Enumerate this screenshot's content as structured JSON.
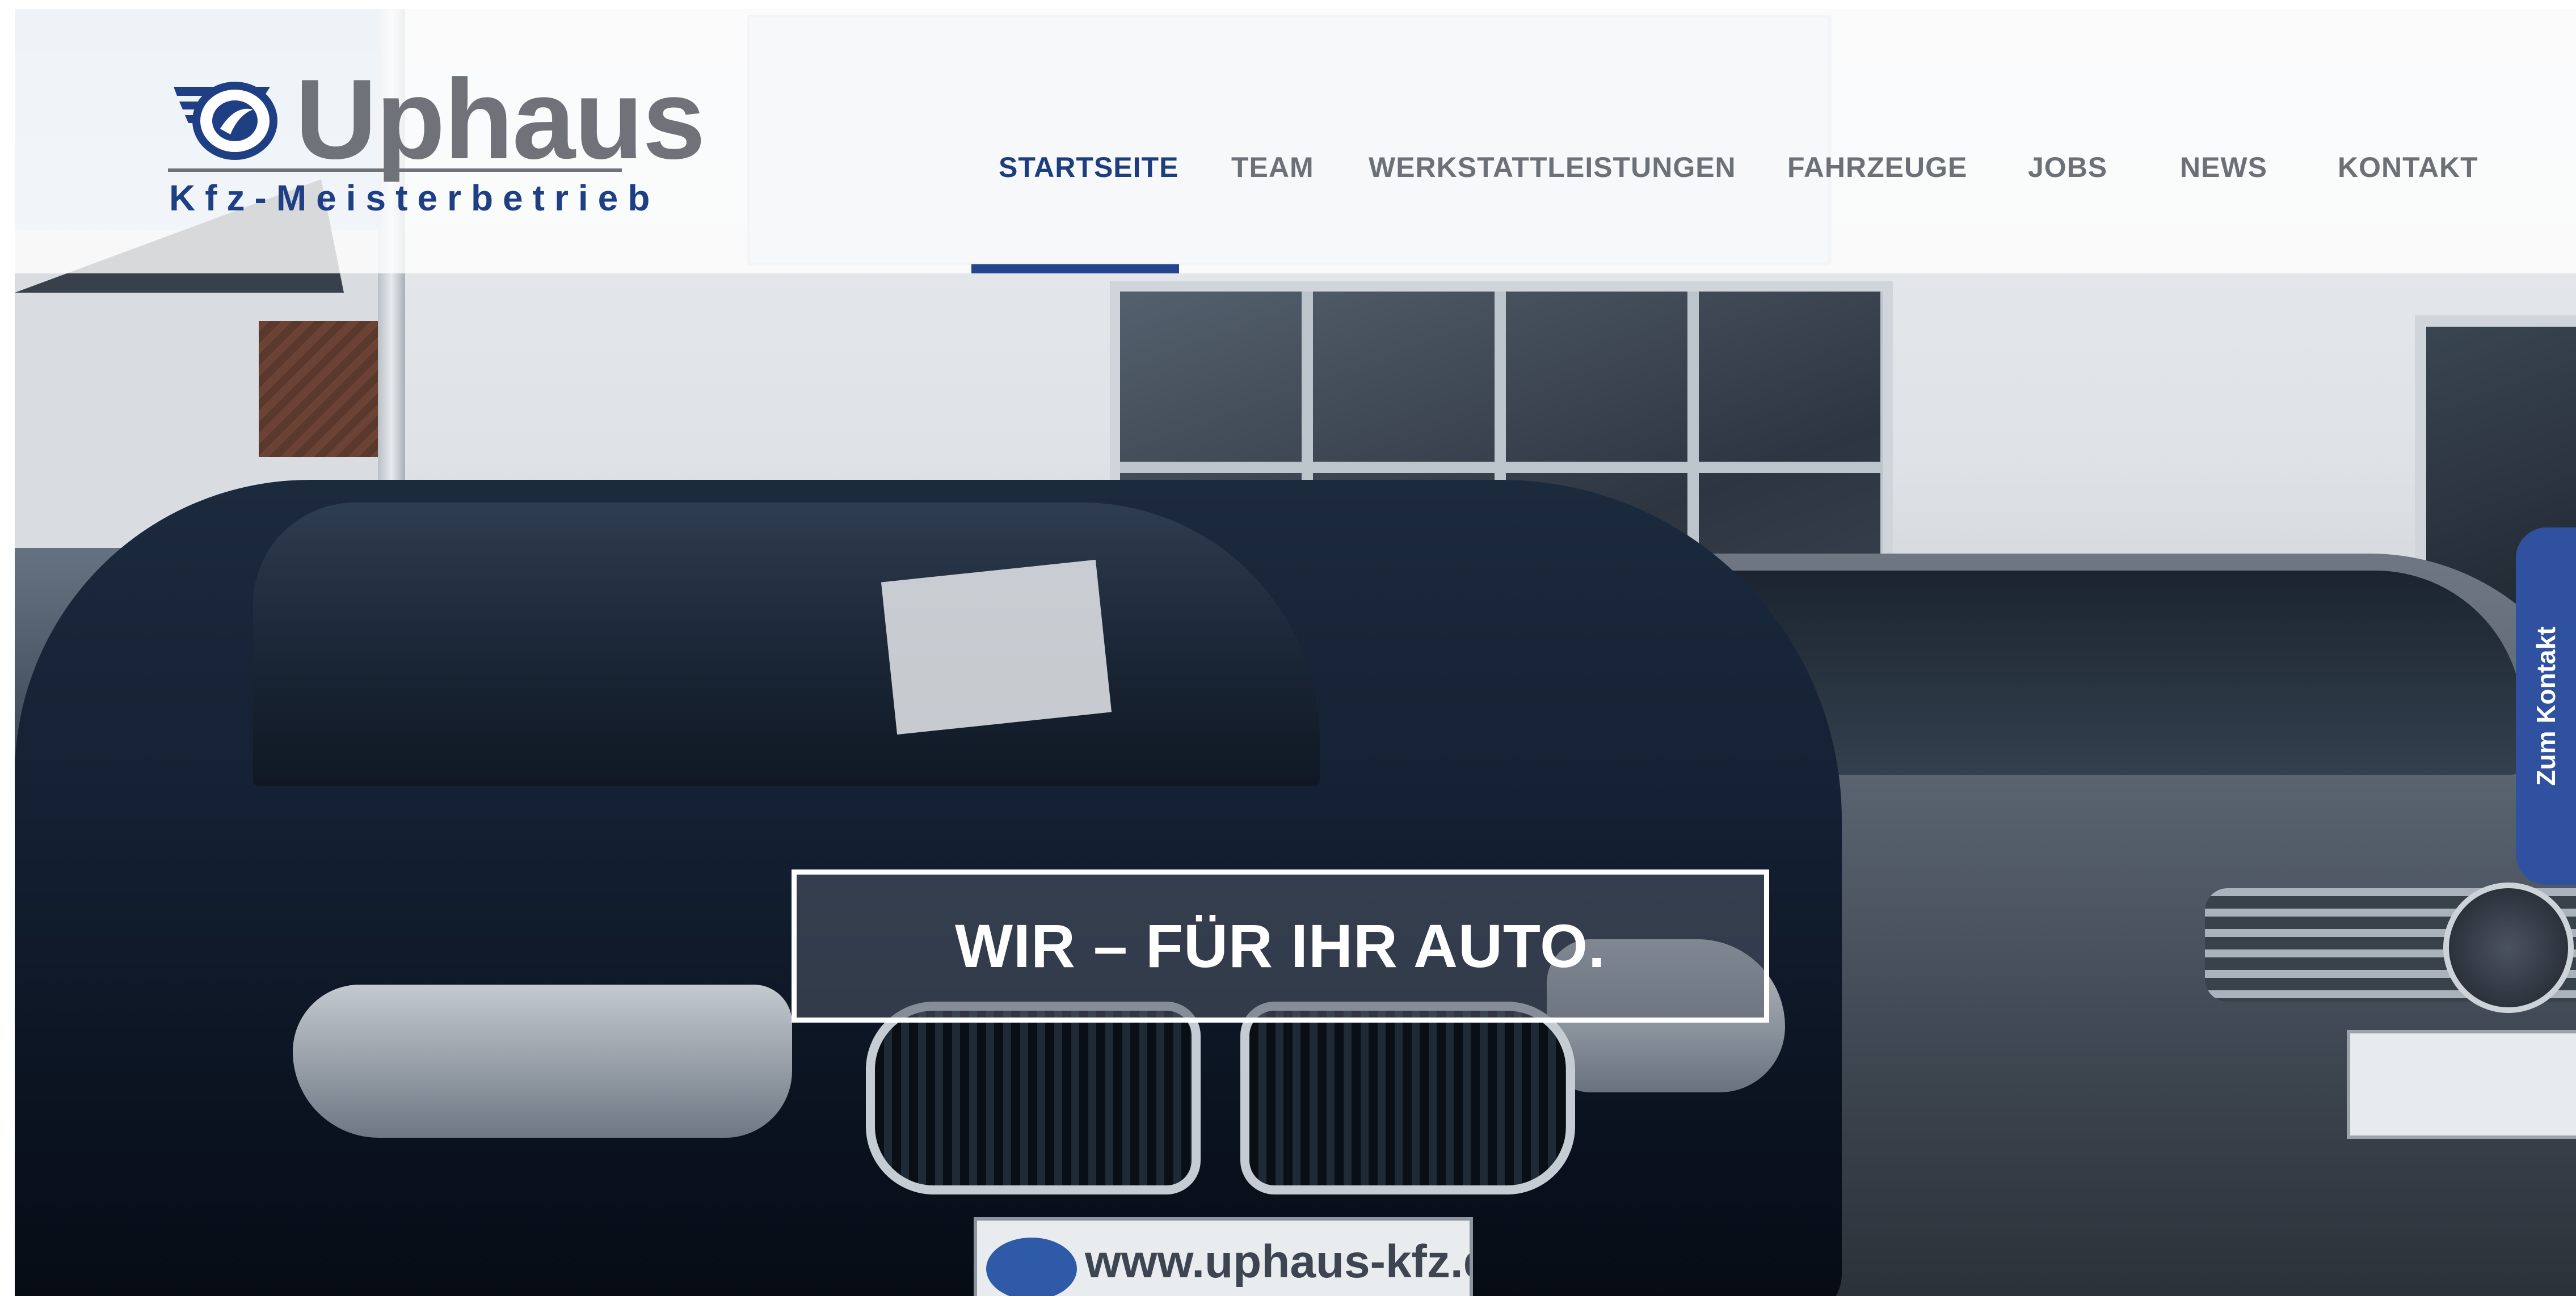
{
  "brand": {
    "name": "Uphaus",
    "subtitle": "Kfz-Meisterbetrieb",
    "logo_icon": "uphaus-wing-logo-icon",
    "colors": {
      "primary": "#24448d",
      "word_grey": "#6f7379",
      "nav_grey": "#6c7178"
    }
  },
  "nav": {
    "items": [
      {
        "label": "STARTSEITE",
        "active": true
      },
      {
        "label": "TEAM",
        "active": false
      },
      {
        "label": "WERKSTATTLEISTUNGEN",
        "active": false
      },
      {
        "label": "FAHRZEUGE",
        "active": false
      },
      {
        "label": "JOBS",
        "active": false
      },
      {
        "label": "NEWS",
        "active": false
      },
      {
        "label": "KONTAKT",
        "active": false
      }
    ]
  },
  "hero": {
    "title": "WIR – FÜR IHR AUTO.",
    "plate_text": "www.uphaus-kfz.de"
  },
  "side_tab": {
    "label": "Zum Kontakt",
    "color": "#2f51a0"
  }
}
